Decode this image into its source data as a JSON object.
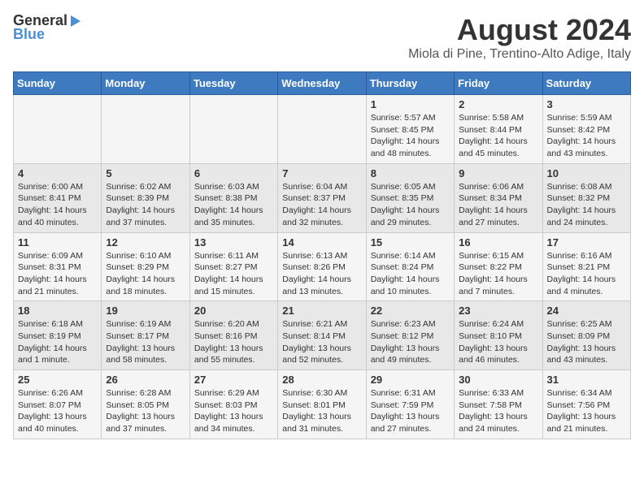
{
  "logo": {
    "line1": "General",
    "line2": "Blue"
  },
  "title": "August 2024",
  "subtitle": "Miola di Pine, Trentino-Alto Adige, Italy",
  "headers": [
    "Sunday",
    "Monday",
    "Tuesday",
    "Wednesday",
    "Thursday",
    "Friday",
    "Saturday"
  ],
  "weeks": [
    [
      {
        "day": "",
        "info": ""
      },
      {
        "day": "",
        "info": ""
      },
      {
        "day": "",
        "info": ""
      },
      {
        "day": "",
        "info": ""
      },
      {
        "day": "1",
        "info": "Sunrise: 5:57 AM\nSunset: 8:45 PM\nDaylight: 14 hours\nand 48 minutes."
      },
      {
        "day": "2",
        "info": "Sunrise: 5:58 AM\nSunset: 8:44 PM\nDaylight: 14 hours\nand 45 minutes."
      },
      {
        "day": "3",
        "info": "Sunrise: 5:59 AM\nSunset: 8:42 PM\nDaylight: 14 hours\nand 43 minutes."
      }
    ],
    [
      {
        "day": "4",
        "info": "Sunrise: 6:00 AM\nSunset: 8:41 PM\nDaylight: 14 hours\nand 40 minutes."
      },
      {
        "day": "5",
        "info": "Sunrise: 6:02 AM\nSunset: 8:39 PM\nDaylight: 14 hours\nand 37 minutes."
      },
      {
        "day": "6",
        "info": "Sunrise: 6:03 AM\nSunset: 8:38 PM\nDaylight: 14 hours\nand 35 minutes."
      },
      {
        "day": "7",
        "info": "Sunrise: 6:04 AM\nSunset: 8:37 PM\nDaylight: 14 hours\nand 32 minutes."
      },
      {
        "day": "8",
        "info": "Sunrise: 6:05 AM\nSunset: 8:35 PM\nDaylight: 14 hours\nand 29 minutes."
      },
      {
        "day": "9",
        "info": "Sunrise: 6:06 AM\nSunset: 8:34 PM\nDaylight: 14 hours\nand 27 minutes."
      },
      {
        "day": "10",
        "info": "Sunrise: 6:08 AM\nSunset: 8:32 PM\nDaylight: 14 hours\nand 24 minutes."
      }
    ],
    [
      {
        "day": "11",
        "info": "Sunrise: 6:09 AM\nSunset: 8:31 PM\nDaylight: 14 hours\nand 21 minutes."
      },
      {
        "day": "12",
        "info": "Sunrise: 6:10 AM\nSunset: 8:29 PM\nDaylight: 14 hours\nand 18 minutes."
      },
      {
        "day": "13",
        "info": "Sunrise: 6:11 AM\nSunset: 8:27 PM\nDaylight: 14 hours\nand 15 minutes."
      },
      {
        "day": "14",
        "info": "Sunrise: 6:13 AM\nSunset: 8:26 PM\nDaylight: 14 hours\nand 13 minutes."
      },
      {
        "day": "15",
        "info": "Sunrise: 6:14 AM\nSunset: 8:24 PM\nDaylight: 14 hours\nand 10 minutes."
      },
      {
        "day": "16",
        "info": "Sunrise: 6:15 AM\nSunset: 8:22 PM\nDaylight: 14 hours\nand 7 minutes."
      },
      {
        "day": "17",
        "info": "Sunrise: 6:16 AM\nSunset: 8:21 PM\nDaylight: 14 hours\nand 4 minutes."
      }
    ],
    [
      {
        "day": "18",
        "info": "Sunrise: 6:18 AM\nSunset: 8:19 PM\nDaylight: 14 hours\nand 1 minute."
      },
      {
        "day": "19",
        "info": "Sunrise: 6:19 AM\nSunset: 8:17 PM\nDaylight: 13 hours\nand 58 minutes."
      },
      {
        "day": "20",
        "info": "Sunrise: 6:20 AM\nSunset: 8:16 PM\nDaylight: 13 hours\nand 55 minutes."
      },
      {
        "day": "21",
        "info": "Sunrise: 6:21 AM\nSunset: 8:14 PM\nDaylight: 13 hours\nand 52 minutes."
      },
      {
        "day": "22",
        "info": "Sunrise: 6:23 AM\nSunset: 8:12 PM\nDaylight: 13 hours\nand 49 minutes."
      },
      {
        "day": "23",
        "info": "Sunrise: 6:24 AM\nSunset: 8:10 PM\nDaylight: 13 hours\nand 46 minutes."
      },
      {
        "day": "24",
        "info": "Sunrise: 6:25 AM\nSunset: 8:09 PM\nDaylight: 13 hours\nand 43 minutes."
      }
    ],
    [
      {
        "day": "25",
        "info": "Sunrise: 6:26 AM\nSunset: 8:07 PM\nDaylight: 13 hours\nand 40 minutes."
      },
      {
        "day": "26",
        "info": "Sunrise: 6:28 AM\nSunset: 8:05 PM\nDaylight: 13 hours\nand 37 minutes."
      },
      {
        "day": "27",
        "info": "Sunrise: 6:29 AM\nSunset: 8:03 PM\nDaylight: 13 hours\nand 34 minutes."
      },
      {
        "day": "28",
        "info": "Sunrise: 6:30 AM\nSunset: 8:01 PM\nDaylight: 13 hours\nand 31 minutes."
      },
      {
        "day": "29",
        "info": "Sunrise: 6:31 AM\nSunset: 7:59 PM\nDaylight: 13 hours\nand 27 minutes."
      },
      {
        "day": "30",
        "info": "Sunrise: 6:33 AM\nSunset: 7:58 PM\nDaylight: 13 hours\nand 24 minutes."
      },
      {
        "day": "31",
        "info": "Sunrise: 6:34 AM\nSunset: 7:56 PM\nDaylight: 13 hours\nand 21 minutes."
      }
    ]
  ]
}
